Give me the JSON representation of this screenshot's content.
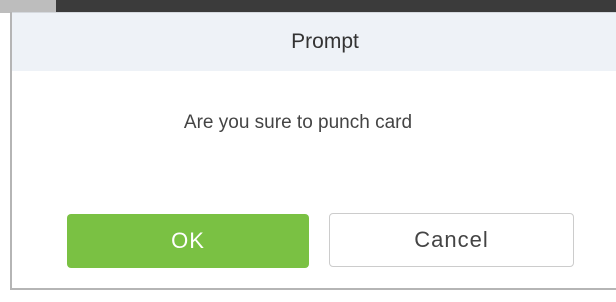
{
  "dialog": {
    "title": "Prompt",
    "message": "Are you sure to punch card",
    "ok_label": "OK",
    "cancel_label": "Cancel"
  },
  "colors": {
    "ok_button_bg": "#7ac143",
    "header_bg": "#eef2f7",
    "top_bar": "#3b3b3b"
  }
}
